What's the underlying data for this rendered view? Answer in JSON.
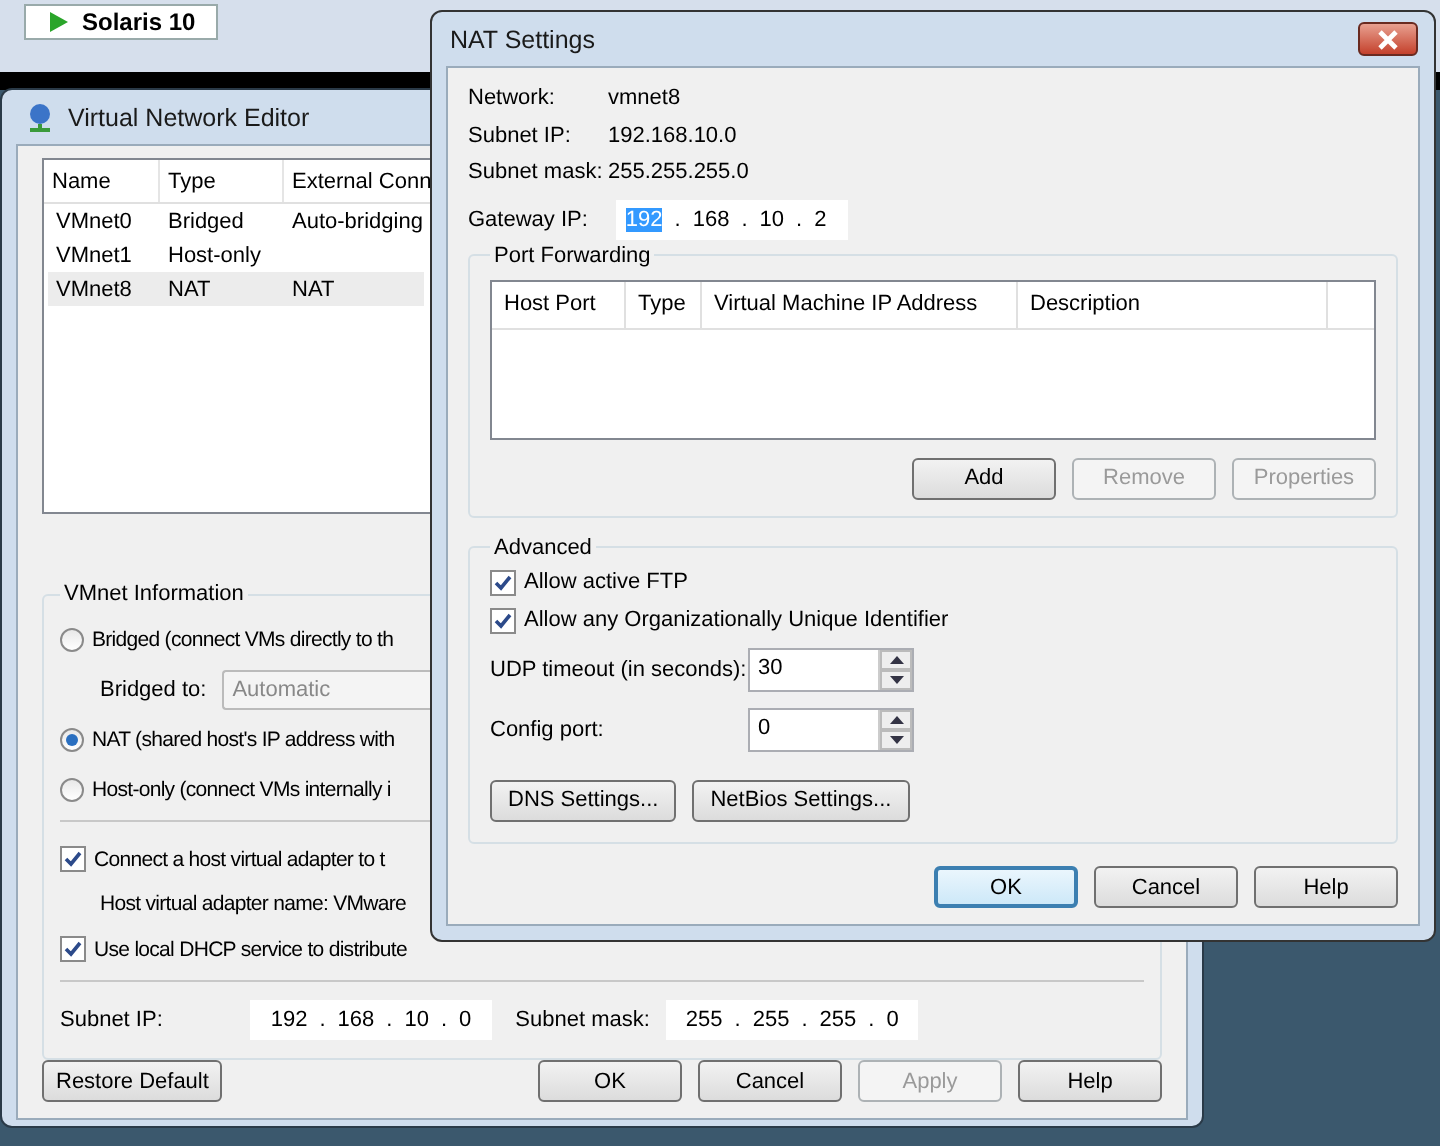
{
  "background_tab": {
    "label": "Solaris 10"
  },
  "network_editor": {
    "title": "Virtual Network Editor",
    "columns": [
      "Name",
      "Type",
      "External Conn"
    ],
    "rows": [
      {
        "name": "VMnet0",
        "type": "Bridged",
        "external": "Auto-bridging",
        "selected": false
      },
      {
        "name": "VMnet1",
        "type": "Host-only",
        "external": "",
        "selected": false
      },
      {
        "name": "VMnet8",
        "type": "NAT",
        "external": "NAT",
        "selected": true
      }
    ],
    "info": {
      "title": "VMnet Information",
      "items": [
        {
          "kind": "radio",
          "label": "Bridged (connect VMs directly to th",
          "selected": false
        },
        {
          "kind": "dropdown",
          "label": "Bridged to:",
          "value": "Automatic",
          "disabled": true
        },
        {
          "kind": "radio",
          "label": "NAT (shared host's IP address with",
          "selected": true
        },
        {
          "kind": "radio",
          "label": "Host-only (connect VMs internally i",
          "selected": false
        },
        {
          "kind": "separator"
        },
        {
          "kind": "checkbox",
          "label": "Connect a host virtual adapter to t",
          "checked": true
        },
        {
          "kind": "note",
          "label": "Host virtual adapter name: VMware"
        },
        {
          "kind": "checkbox",
          "label": "Use local DHCP service to distribute",
          "checked": true
        },
        {
          "kind": "separator"
        }
      ],
      "subnet_ip": {
        "label": "Subnet IP:",
        "octets": [
          {
            "value": "192",
            "selected": false
          },
          {
            "value": "168",
            "selected": false
          },
          {
            "value": "10",
            "selected": false
          },
          {
            "value": "0",
            "selected": false
          }
        ],
        "separator": "."
      },
      "subnet_mask": {
        "label": "Subnet mask:",
        "octets": [
          {
            "value": "255",
            "selected": false
          },
          {
            "value": "255",
            "selected": false
          },
          {
            "value": "255",
            "selected": false
          },
          {
            "value": "0",
            "selected": false
          }
        ],
        "separator": "."
      }
    },
    "restore_button": {
      "label": "Restore Default",
      "disabled": false
    },
    "buttons": [
      {
        "label": "OK",
        "disabled": false
      },
      {
        "label": "Cancel",
        "disabled": false
      },
      {
        "label": "Apply",
        "disabled": true
      },
      {
        "label": "Help",
        "disabled": false
      }
    ]
  },
  "nat_settings": {
    "title": "NAT Settings",
    "info": [
      {
        "label": "Network:",
        "value": "vmnet8"
      },
      {
        "label": "Subnet IP:",
        "value": "192.168.10.0"
      },
      {
        "label": "Subnet mask:",
        "value": "255.255.255.0"
      }
    ],
    "gateway": {
      "label": "Gateway IP:",
      "octets": [
        {
          "value": "192",
          "selected": true
        },
        {
          "value": "168",
          "selected": false
        },
        {
          "value": "10",
          "selected": false
        },
        {
          "value": "2",
          "selected": false
        }
      ],
      "separator": "."
    },
    "port_forwarding": {
      "title": "Port Forwarding",
      "columns": [
        "Host Port",
        "Type",
        "Virtual Machine IP Address",
        "Description"
      ],
      "buttons": [
        {
          "label": "Add",
          "disabled": false
        },
        {
          "label": "Remove",
          "disabled": true
        },
        {
          "label": "Properties",
          "disabled": true
        }
      ]
    },
    "advanced": {
      "title": "Advanced",
      "checkboxes": [
        {
          "label": "Allow active FTP",
          "checked": true
        },
        {
          "label": "Allow any Organizationally Unique Identifier",
          "checked": true
        }
      ],
      "spinners": [
        {
          "label": "UDP timeout (in seconds):",
          "value": "30"
        },
        {
          "label": "Config port:",
          "value": "0"
        }
      ],
      "buttons": [
        {
          "label": "DNS Settings..."
        },
        {
          "label": "NetBios Settings..."
        }
      ]
    },
    "buttons": [
      {
        "label": "OK",
        "default": true
      },
      {
        "label": "Cancel",
        "default": false
      },
      {
        "label": "Help",
        "default": false
      }
    ]
  }
}
